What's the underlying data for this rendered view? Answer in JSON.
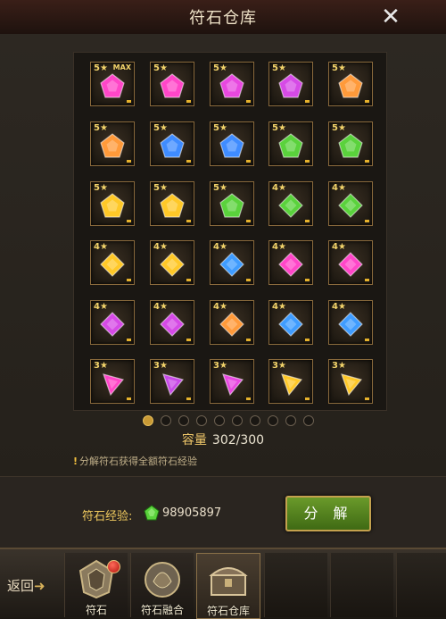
{
  "window": {
    "title": "符石仓库"
  },
  "gems": [
    {
      "stars": "5★",
      "max": "MAX",
      "color": "#ff46c8",
      "shape": "pentagon"
    },
    {
      "stars": "5★",
      "max": "",
      "color": "#ff46c8",
      "shape": "pentagon"
    },
    {
      "stars": "5★",
      "max": "",
      "color": "#e848e0",
      "shape": "pentagon"
    },
    {
      "stars": "5★",
      "max": "",
      "color": "#d64ae6",
      "shape": "pentagon"
    },
    {
      "stars": "5★",
      "max": "",
      "color": "#ff9a3a",
      "shape": "pentagon"
    },
    {
      "stars": "5★",
      "max": "",
      "color": "#ff9a3a",
      "shape": "pentagon"
    },
    {
      "stars": "5★",
      "max": "",
      "color": "#3f8cff",
      "shape": "pentagon"
    },
    {
      "stars": "5★",
      "max": "",
      "color": "#3f8cff",
      "shape": "pentagon"
    },
    {
      "stars": "5★",
      "max": "",
      "color": "#5ad23c",
      "shape": "pentagon"
    },
    {
      "stars": "5★",
      "max": "",
      "color": "#5ad23c",
      "shape": "pentagon"
    },
    {
      "stars": "5★",
      "max": "",
      "color": "#ffc828",
      "shape": "pentagon"
    },
    {
      "stars": "5★",
      "max": "",
      "color": "#ffc828",
      "shape": "pentagon"
    },
    {
      "stars": "5★",
      "max": "",
      "color": "#5ad23c",
      "shape": "pentagon"
    },
    {
      "stars": "4★",
      "max": "",
      "color": "#5ad23c",
      "shape": "diamond"
    },
    {
      "stars": "4★",
      "max": "",
      "color": "#5ad23c",
      "shape": "diamond"
    },
    {
      "stars": "4★",
      "max": "",
      "color": "#ffc828",
      "shape": "diamond"
    },
    {
      "stars": "4★",
      "max": "",
      "color": "#ffc828",
      "shape": "diamond"
    },
    {
      "stars": "4★",
      "max": "",
      "color": "#3f9cff",
      "shape": "diamond"
    },
    {
      "stars": "4★",
      "max": "",
      "color": "#ff46c8",
      "shape": "diamond"
    },
    {
      "stars": "4★",
      "max": "",
      "color": "#ff46c8",
      "shape": "diamond"
    },
    {
      "stars": "4★",
      "max": "",
      "color": "#d64ae6",
      "shape": "diamond"
    },
    {
      "stars": "4★",
      "max": "",
      "color": "#d64ae6",
      "shape": "diamond"
    },
    {
      "stars": "4★",
      "max": "",
      "color": "#ff9a3a",
      "shape": "diamond"
    },
    {
      "stars": "4★",
      "max": "",
      "color": "#3f9cff",
      "shape": "diamond"
    },
    {
      "stars": "4★",
      "max": "",
      "color": "#3f9cff",
      "shape": "diamond"
    },
    {
      "stars": "3★",
      "max": "",
      "color": "#ff46c8",
      "shape": "triangle"
    },
    {
      "stars": "3★",
      "max": "",
      "color": "#c84ae6",
      "shape": "triangle"
    },
    {
      "stars": "3★",
      "max": "",
      "color": "#e848e0",
      "shape": "triangle"
    },
    {
      "stars": "3★",
      "max": "",
      "color": "#ffc828",
      "shape": "triangle"
    },
    {
      "stars": "3★",
      "max": "",
      "color": "#ffc828",
      "shape": "triangle"
    }
  ],
  "pagination": {
    "pages": 10,
    "current": 1
  },
  "capacity": {
    "label": "容量",
    "value": "302/300"
  },
  "tip": {
    "mark": "!",
    "text": "分解符石获得全额符石经验"
  },
  "experience": {
    "label": "符石经验:",
    "value": "98905897",
    "icon": "green-gem-icon",
    "icon_color": "#5ad23c"
  },
  "actions": {
    "decompose_label": "分 解"
  },
  "tabs": {
    "back_label": "返回",
    "items": [
      {
        "label": "符石",
        "badge": true
      },
      {
        "label": "符石融合",
        "badge": false
      },
      {
        "label": "符石仓库",
        "badge": false,
        "active": true
      }
    ]
  },
  "colors": {
    "accent_gold": "#f0c86a",
    "button_green": "#4f8a1e"
  }
}
